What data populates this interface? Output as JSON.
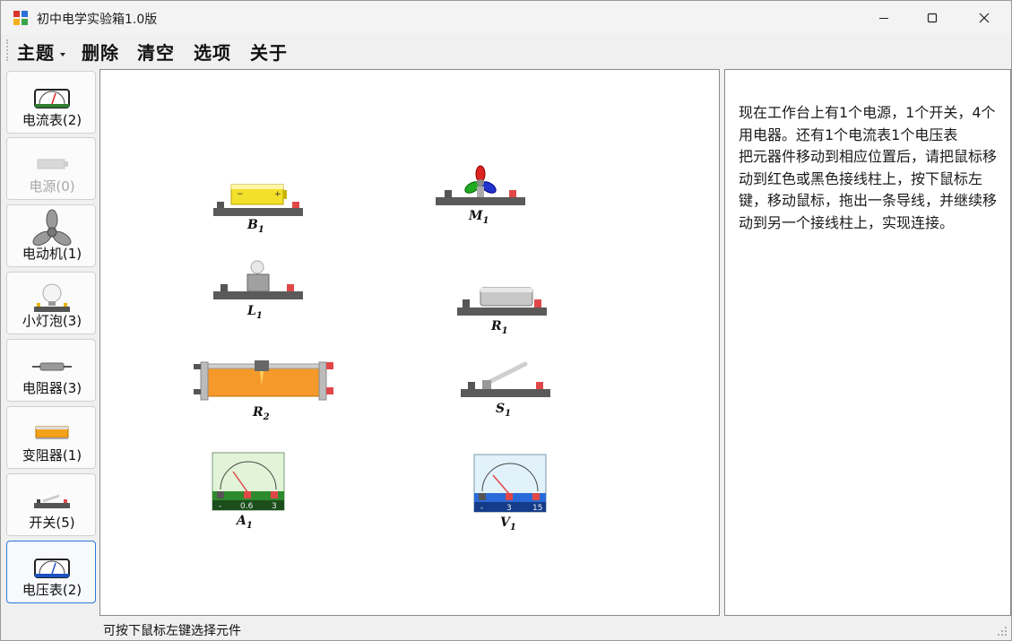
{
  "window": {
    "title": "初中电学实验箱1.0版"
  },
  "menu": {
    "theme": "主题",
    "delete": "删除",
    "clear": "清空",
    "options": "选项",
    "about": "关于"
  },
  "sidebar": {
    "items": [
      {
        "label": "电流表(2)",
        "icon": "ammeter-icon"
      },
      {
        "label": "电源(0)",
        "icon": "battery-icon",
        "disabled": true
      },
      {
        "label": "电动机(1)",
        "icon": "motor-fan-icon"
      },
      {
        "label": "小灯泡(3)",
        "icon": "bulb-icon"
      },
      {
        "label": "电阻器(3)",
        "icon": "resistor-icon"
      },
      {
        "label": "变阻器(1)",
        "icon": "rheostat-icon"
      },
      {
        "label": "开关(5)",
        "icon": "switch-icon"
      },
      {
        "label": "电压表(2)",
        "icon": "voltmeter-icon",
        "active": true
      }
    ]
  },
  "workbench": {
    "components": [
      {
        "id": "B",
        "sub": "1"
      },
      {
        "id": "M",
        "sub": "1"
      },
      {
        "id": "L",
        "sub": "1"
      },
      {
        "id": "R",
        "sub": "1"
      },
      {
        "id": "R",
        "sub": "2"
      },
      {
        "id": "S",
        "sub": "1"
      },
      {
        "id": "A",
        "sub": "1",
        "scale_low": "0.6",
        "scale_high": "3",
        "minus": "-"
      },
      {
        "id": "V",
        "sub": "1",
        "scale_low": "3",
        "scale_high": "15",
        "minus": "-"
      }
    ]
  },
  "info": {
    "text": "现在工作台上有1个电源，1个开关，4个用电器。还有1个电流表1个电压表\n把元器件移动到相应位置后，请把鼠标移动到红色或黑色接线柱上，按下鼠标左键，移动鼠标，拖出一条导线，并继续移动到另一个接线柱上，实现连接。"
  },
  "status": {
    "text": "可按下鼠标左键选择元件"
  },
  "colors": {
    "accent": "#2a7ad5",
    "terminal_red": "#e04848",
    "terminal_black": "#444444",
    "base": "#5a5a5a"
  }
}
